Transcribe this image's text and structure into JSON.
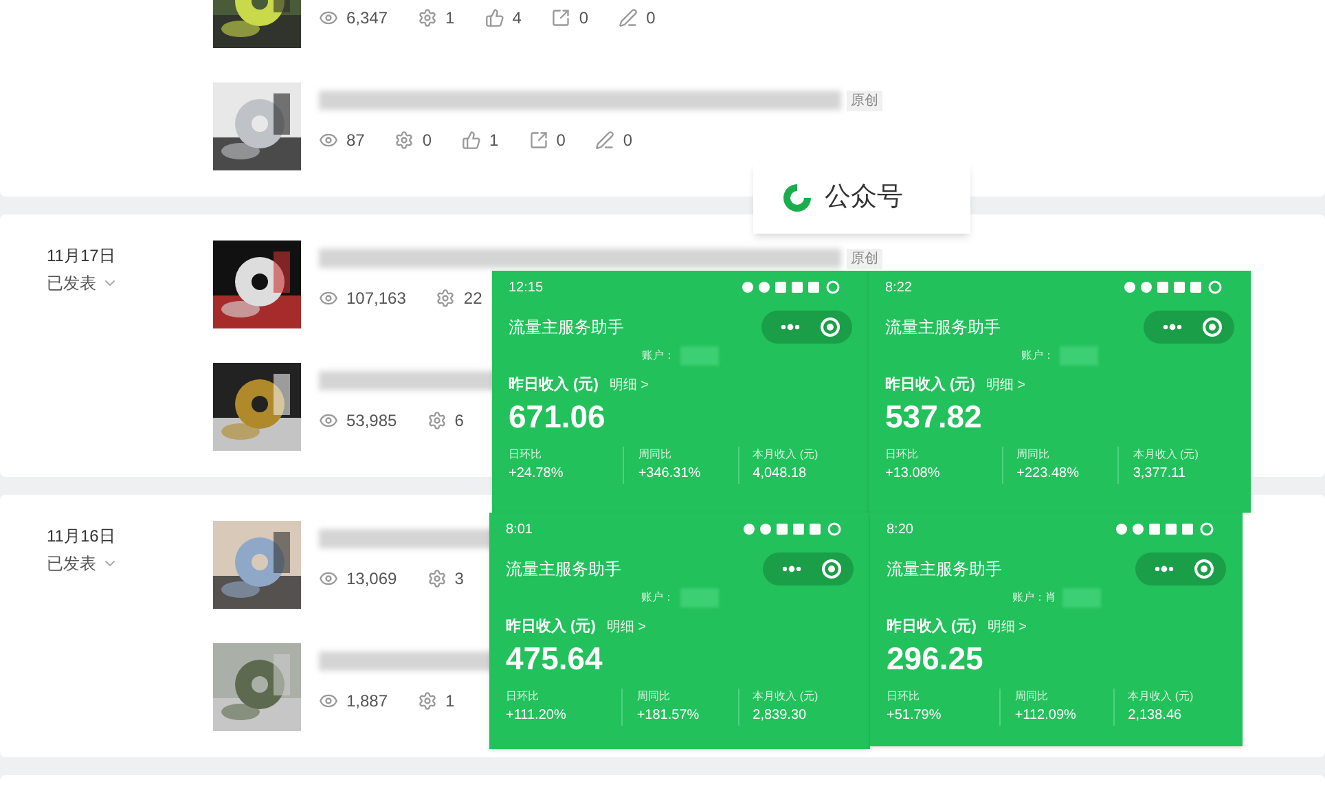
{
  "cards": [
    {
      "articles": [
        {
          "stats": [
            {
              "kind": "views",
              "value": "6,347"
            },
            {
              "kind": "gear",
              "value": "1"
            },
            {
              "kind": "likes",
              "value": "4"
            },
            {
              "kind": "shares",
              "value": "0"
            },
            {
              "kind": "edits",
              "value": "0"
            }
          ]
        },
        {
          "blurred_title": true,
          "tag": "原创",
          "stats": [
            {
              "kind": "views",
              "value": "87"
            },
            {
              "kind": "gear",
              "value": "0"
            },
            {
              "kind": "likes",
              "value": "1"
            },
            {
              "kind": "shares",
              "value": "0"
            },
            {
              "kind": "edits",
              "value": "0"
            }
          ]
        }
      ]
    },
    {
      "date": "11月17日",
      "status": "已发表",
      "articles": [
        {
          "blurred_title": true,
          "tag": "原创",
          "stats": [
            {
              "kind": "views",
              "value": "107,163"
            },
            {
              "kind": "gear",
              "value": "22"
            }
          ]
        },
        {
          "blurred_title": true,
          "stats": [
            {
              "kind": "views",
              "value": "53,985"
            },
            {
              "kind": "gear",
              "value": "6"
            }
          ]
        }
      ]
    },
    {
      "date": "11月16日",
      "status": "已发表",
      "articles": [
        {
          "blurred_title": true,
          "stats": [
            {
              "kind": "views",
              "value": "13,069"
            },
            {
              "kind": "gear",
              "value": "3"
            }
          ]
        },
        {
          "blurred_title": true,
          "stats": [
            {
              "kind": "views",
              "value": "1,887"
            },
            {
              "kind": "gear",
              "value": "1"
            }
          ]
        }
      ]
    }
  ],
  "account_label": {
    "text": "公众号"
  },
  "panels": [
    {
      "time": "12:15",
      "title": "流量主服务助手",
      "account": "账户：",
      "income_label": "昨日收入 (元)",
      "detail": "明细 >",
      "amount": "671.06",
      "stats": [
        {
          "label": "日环比",
          "value": "+24.78%"
        },
        {
          "label": "周同比",
          "value": "+346.31%"
        },
        {
          "label": "本月收入 (元)",
          "value": "4,048.18"
        }
      ]
    },
    {
      "time": "8:22",
      "title": "流量主服务助手",
      "account": "账户：",
      "income_label": "昨日收入 (元)",
      "detail": "明细 >",
      "amount": "537.82",
      "stats": [
        {
          "label": "日环比",
          "value": "+13.08%"
        },
        {
          "label": "周同比",
          "value": "+223.48%"
        },
        {
          "label": "本月收入 (元)",
          "value": "3,377.11"
        }
      ]
    },
    {
      "time": "8:01",
      "title": "流量主服务助手",
      "account": "账户：",
      "income_label": "昨日收入 (元)",
      "detail": "明细 >",
      "amount": "475.64",
      "stats": [
        {
          "label": "日环比",
          "value": "+111.20%"
        },
        {
          "label": "周同比",
          "value": "+181.57%"
        },
        {
          "label": "本月收入 (元)",
          "value": "2,839.30"
        }
      ]
    },
    {
      "time": "8:20",
      "title": "流量主服务助手",
      "account": "账户：肖",
      "income_label": "昨日收入 (元)",
      "detail": "明细 >",
      "amount": "296.25",
      "stats": [
        {
          "label": "日环比",
          "value": "+51.79%"
        },
        {
          "label": "周同比",
          "value": "+112.09%"
        },
        {
          "label": "本月收入 (元)",
          "value": "2,138.46"
        }
      ]
    }
  ]
}
